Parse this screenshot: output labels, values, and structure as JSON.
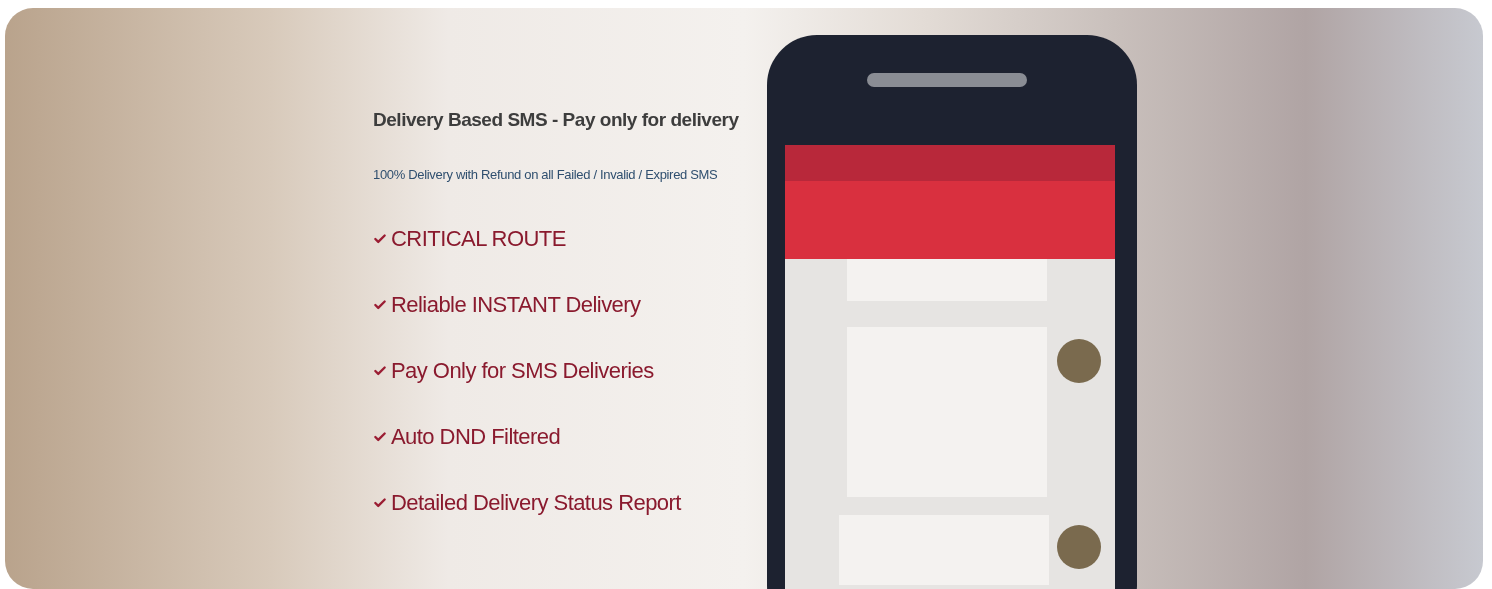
{
  "banner": {
    "title": "Delivery Based SMS - Pay only for delivery",
    "subtitle": "100% Delivery with Refund on all Failed / Invalid / Expired SMS",
    "features": [
      "CRITICAL ROUTE",
      "Reliable INSTANT Delivery",
      "Pay Only for SMS Deliveries",
      "Auto DND Filtered",
      "Detailed Delivery Status Report"
    ]
  }
}
